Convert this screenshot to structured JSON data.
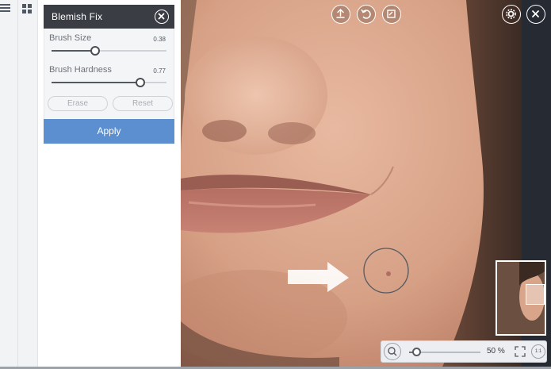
{
  "panel": {
    "title": "Blemish Fix",
    "sliders": [
      {
        "label": "Brush Size",
        "value_text": "0.38",
        "value": 0.38
      },
      {
        "label": "Brush Hardness",
        "value_text": "0.77",
        "value": 0.77
      }
    ],
    "erase_label": "Erase",
    "reset_label": "Reset",
    "apply_label": "Apply"
  },
  "zoom": {
    "value_text": "50 %",
    "level": 0.1,
    "actual_size_label": "1:1"
  },
  "colors": {
    "accent": "#5b8fcf",
    "panel_header": "#3a3d44",
    "right_strip": "#252a33"
  },
  "icons": {
    "rail": [
      "menu-icon",
      "grid-icon"
    ],
    "canvas_tools": [
      "upload-icon",
      "undo-icon",
      "compare-icon",
      "settings-icon",
      "close-icon"
    ],
    "zoom": [
      "zoom-icon",
      "fit-screen-icon",
      "actual-size-icon"
    ]
  }
}
